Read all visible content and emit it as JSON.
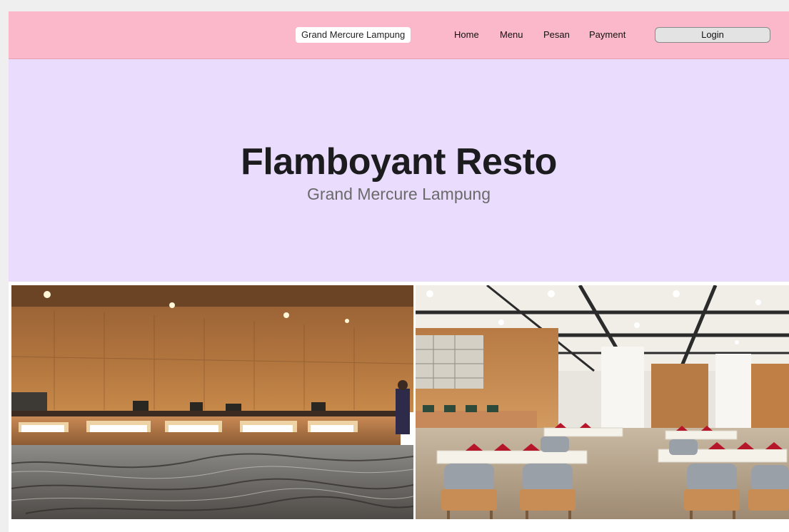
{
  "navbar": {
    "brand": "Grand Mercure Lampung",
    "links": [
      "Home",
      "Menu",
      "Pesan",
      "Payment"
    ],
    "login_label": "Login"
  },
  "hero": {
    "title": "Flamboyant Resto",
    "subtitle": "Grand Mercure Lampung"
  },
  "colors": {
    "navbar": "#fcb8cb",
    "hero": "#e9dcfd"
  },
  "gallery": {
    "photos": [
      "buffet-counter-photo",
      "dining-hall-photo"
    ]
  }
}
